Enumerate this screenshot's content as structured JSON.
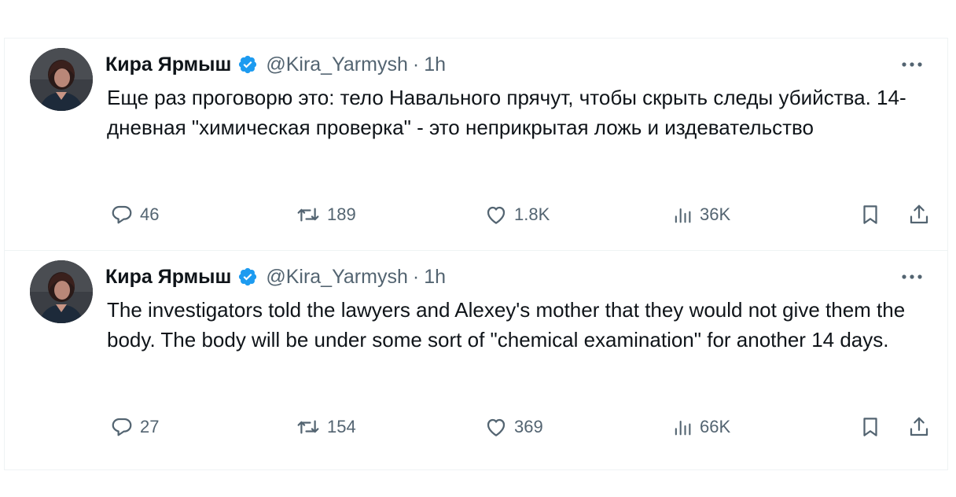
{
  "tweets": [
    {
      "author_name": "Кира Ярмыш",
      "handle": "@Kira_Yarmysh",
      "separator": "·",
      "time": "1h",
      "text": "Еще раз проговорю это: тело Навального прячут, чтобы скрыть следы убийства. 14-дневная \"химическая проверка\" - это неприкрытая ложь и издевательство",
      "replies": "46",
      "retweets": "189",
      "likes": "1.8K",
      "views": "36K"
    },
    {
      "author_name": "Кира Ярмыш",
      "handle": "@Kira_Yarmysh",
      "separator": "·",
      "time": "1h",
      "text": "The investigators told the lawyers and Alexey's mother that they would not give them the body. The body will be under some sort of \"chemical examination\" for another 14 days.",
      "replies": "27",
      "retweets": "154",
      "likes": "369",
      "views": "66K"
    }
  ],
  "icons": {
    "verified": "verified-badge-icon",
    "more": "more-horizontal-icon",
    "reply": "reply-bubble-icon",
    "retweet": "retweet-icon",
    "like": "heart-icon",
    "views": "views-bar-chart-icon",
    "bookmark": "bookmark-icon",
    "share": "share-upload-icon"
  },
  "colors": {
    "text_primary": "#0f1419",
    "text_secondary": "#536471",
    "verified_blue": "#1d9bf0",
    "divider": "#eff3f4"
  }
}
